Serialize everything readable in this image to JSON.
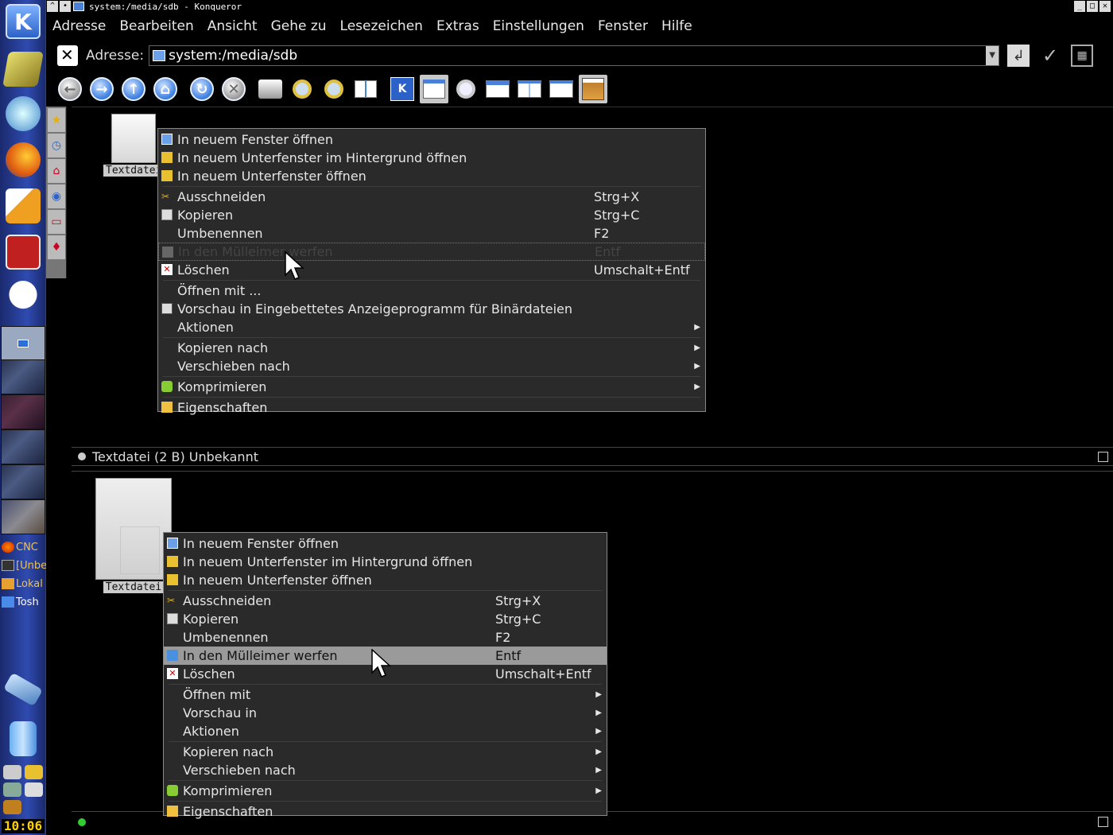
{
  "window": {
    "title": "system:/media/sdb - Konqueror",
    "controls": [
      "_",
      "□",
      "✕"
    ]
  },
  "menubar": [
    "Adresse",
    "Bearbeiten",
    "Ansicht",
    "Gehe zu",
    "Lesezeichen",
    "Extras",
    "Einstellungen",
    "Fenster",
    "Hilfe"
  ],
  "address": {
    "label": "Adresse:",
    "value": "system:/media/sdb"
  },
  "toolbar": {
    "icons": [
      "back-icon",
      "forward-icon",
      "up-icon",
      "home-icon",
      "reload-icon",
      "stop-icon",
      "print-icon",
      "zoom-in-icon",
      "zoom-out-icon",
      "icon-view-icon",
      "kde-icon",
      "split-view-icon",
      "find-icon",
      "view-top-icon",
      "view-split-icon",
      "view-single-icon",
      "image-icon"
    ]
  },
  "taskbar": {
    "tasks": [
      {
        "label": "CNC",
        "icon": "firefox-icon"
      },
      {
        "label": "[Unbe",
        "icon": "terminal-icon"
      },
      {
        "label": "Lokal",
        "icon": "folder-icon"
      },
      {
        "label": "Tosh",
        "icon": "folder-icon"
      }
    ],
    "clock": "10:06"
  },
  "view1": {
    "file_label": "Textdatei",
    "status": "Textdatei (2 B)  Unbekannt"
  },
  "view2": {
    "file_label": "Textdatei"
  },
  "menu1": {
    "items": [
      {
        "label": "In neuem Fenster öffnen",
        "shortcut": "",
        "icon": "new-window-icon"
      },
      {
        "label": "In neuem Unterfenster im Hintergrund öffnen",
        "shortcut": "",
        "icon": "new-tab-icon"
      },
      {
        "label": "In neuem Unterfenster öffnen",
        "shortcut": "",
        "icon": "new-tab-icon"
      },
      {
        "label": "Ausschneiden",
        "shortcut": "Strg+X",
        "icon": "cut-icon"
      },
      {
        "label": "Kopieren",
        "shortcut": "Strg+C",
        "icon": "copy-icon"
      },
      {
        "label": "Umbenennen",
        "shortcut": "F2",
        "icon": ""
      },
      {
        "label": "In den Mülleimer werfen",
        "shortcut": "Entf",
        "icon": "trash-icon"
      },
      {
        "label": "Löschen",
        "shortcut": "Umschalt+Entf",
        "icon": "delete-icon"
      },
      {
        "label": "Öffnen mit ...",
        "shortcut": "",
        "icon": ""
      },
      {
        "label": "Vorschau in Eingebettetes Anzeigeprogramm für Binärdateien",
        "shortcut": "",
        "icon": "preview-icon"
      },
      {
        "label": "Aktionen",
        "shortcut": "",
        "icon": ""
      },
      {
        "label": "Kopieren nach",
        "shortcut": "",
        "icon": ""
      },
      {
        "label": "Verschieben nach",
        "shortcut": "",
        "icon": ""
      },
      {
        "label": "Komprimieren",
        "shortcut": "",
        "icon": "compress-icon"
      },
      {
        "label": "Eigenschaften",
        "shortcut": "",
        "icon": "properties-icon"
      }
    ]
  },
  "menu2": {
    "items": [
      {
        "label": "In neuem Fenster öffnen",
        "shortcut": "",
        "icon": "new-window-icon"
      },
      {
        "label": "In neuem Unterfenster im Hintergrund öffnen",
        "shortcut": "",
        "icon": "new-tab-icon"
      },
      {
        "label": "In neuem Unterfenster öffnen",
        "shortcut": "",
        "icon": "new-tab-icon"
      },
      {
        "label": "Ausschneiden",
        "shortcut": "Strg+X",
        "icon": "cut-icon"
      },
      {
        "label": "Kopieren",
        "shortcut": "Strg+C",
        "icon": "copy-icon"
      },
      {
        "label": "Umbenennen",
        "shortcut": "F2",
        "icon": ""
      },
      {
        "label": "In den Mülleimer werfen",
        "shortcut": "Entf",
        "icon": "trash-icon"
      },
      {
        "label": "Löschen",
        "shortcut": "Umschalt+Entf",
        "icon": "delete-icon"
      },
      {
        "label": "Öffnen mit",
        "shortcut": "",
        "icon": ""
      },
      {
        "label": "Vorschau in",
        "shortcut": "",
        "icon": ""
      },
      {
        "label": "Aktionen",
        "shortcut": "",
        "icon": ""
      },
      {
        "label": "Kopieren nach",
        "shortcut": "",
        "icon": ""
      },
      {
        "label": "Verschieben nach",
        "shortcut": "",
        "icon": ""
      },
      {
        "label": "Komprimieren",
        "shortcut": "",
        "icon": "compress-icon"
      },
      {
        "label": "Eigenschaften",
        "shortcut": "",
        "icon": "properties-icon"
      }
    ]
  }
}
